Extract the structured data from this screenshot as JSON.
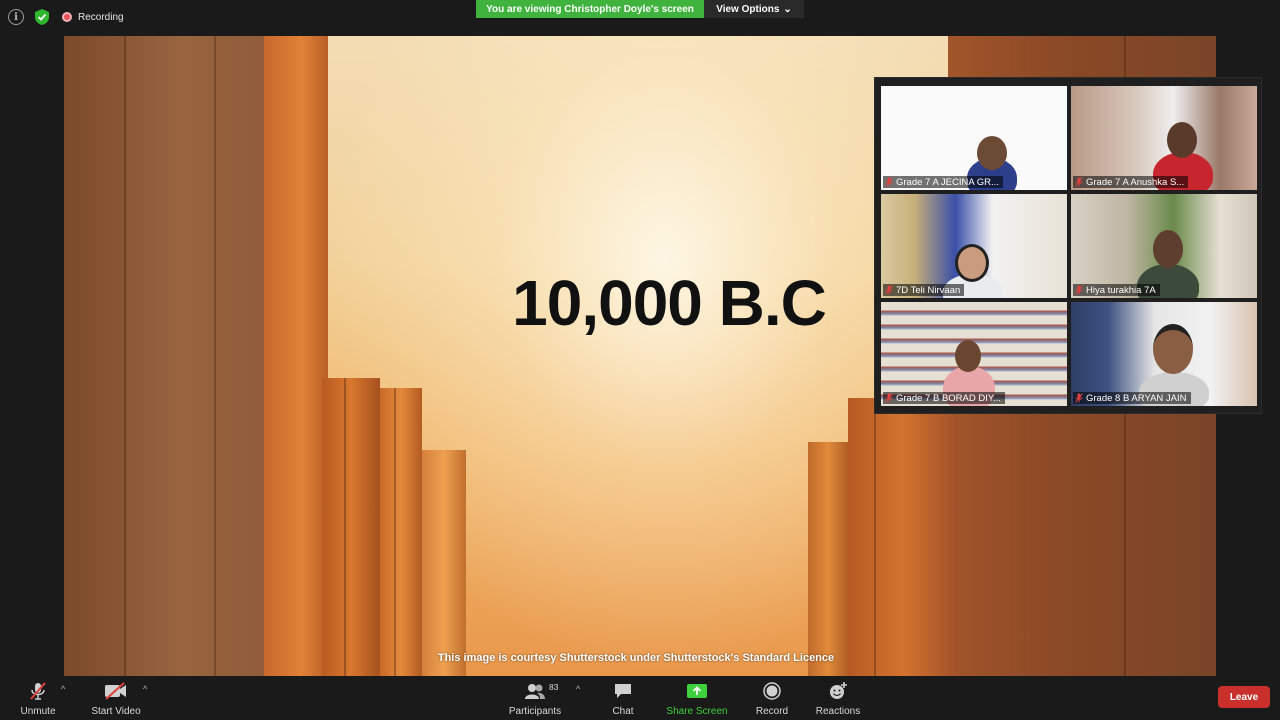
{
  "topbar": {
    "recording_label": "Recording",
    "viewing_banner": "You are viewing Christopher Doyle's screen",
    "view_options_label": "View Options"
  },
  "slide": {
    "title": "10,000 B.C",
    "credit": "This image is courtesy Shutterstock under Shutterstock's Standard Licence"
  },
  "gallery": {
    "participants": [
      {
        "name": "Grade 7 A JECINA GR...",
        "muted": true
      },
      {
        "name": "Grade 7 A Anushka S...",
        "muted": true
      },
      {
        "name": "7D Teli Nirvaan",
        "muted": true
      },
      {
        "name": "Hiya turakhia 7A",
        "muted": true
      },
      {
        "name": "Grade 7 B BORAD DIY...",
        "muted": true
      },
      {
        "name": "Grade 8 B ARYAN JAIN",
        "muted": true
      }
    ]
  },
  "toolbar": {
    "unmute_label": "Unmute",
    "start_video_label": "Start Video",
    "participants_label": "Participants",
    "participants_count": "83",
    "chat_label": "Chat",
    "share_screen_label": "Share Screen",
    "record_label": "Record",
    "reactions_label": "Reactions",
    "leave_label": "Leave"
  },
  "colors": {
    "accent_green": "#3fb33d",
    "leave_red": "#c9302c",
    "recording_red": "#e8535a",
    "muted_red": "#e04040"
  },
  "icons": [
    "info-icon",
    "shield-icon",
    "recording-icon",
    "chevron-down-icon",
    "mic-off-icon",
    "video-off-icon",
    "participants-icon",
    "chat-icon",
    "share-screen-icon",
    "record-icon",
    "reactions-icon"
  ]
}
